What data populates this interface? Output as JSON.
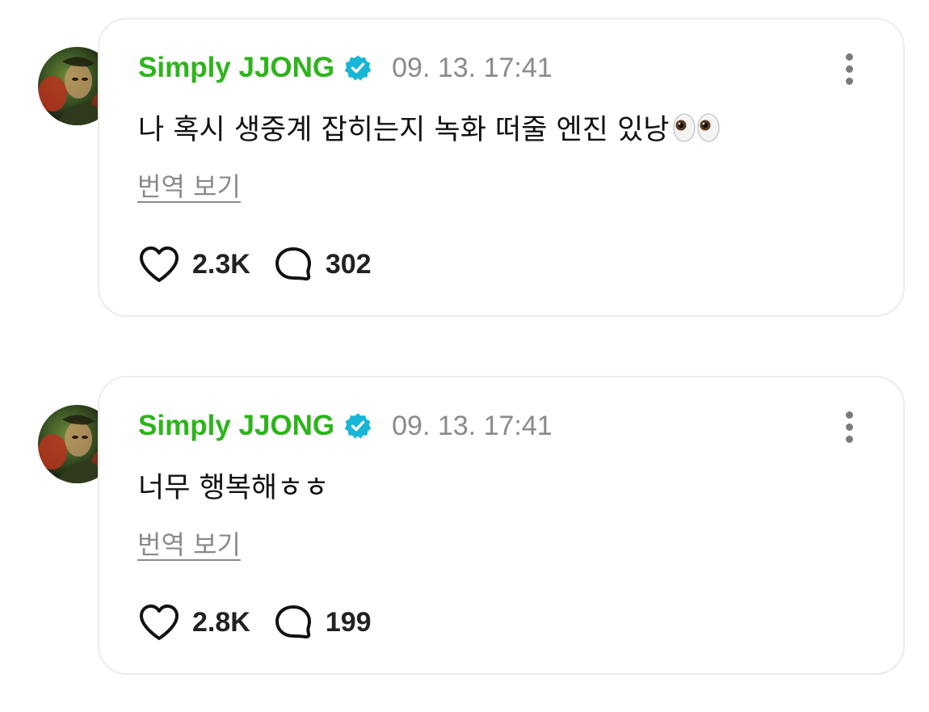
{
  "colors": {
    "username": "#2db41b",
    "verified_badge": "#17b5d8",
    "muted_text": "#8a8a8a",
    "card_border": "#ececec"
  },
  "posts": [
    {
      "username": "Simply JJONG",
      "verified_icon": "verified-badge-icon",
      "timestamp": "09. 13. 17:41",
      "text": "나 혹시 생중계 잡히는지 녹화 떠줄 엔진 있낭",
      "emoji": "eyes-emoji",
      "translate_label": "번역 보기",
      "likes": "2.3K",
      "comments": "302"
    },
    {
      "username": "Simply JJONG",
      "verified_icon": "verified-badge-icon",
      "timestamp": "09. 13. 17:41",
      "text": "너무 행복해ㅎㅎ",
      "translate_label": "번역 보기",
      "likes": "2.8K",
      "comments": "199"
    }
  ]
}
